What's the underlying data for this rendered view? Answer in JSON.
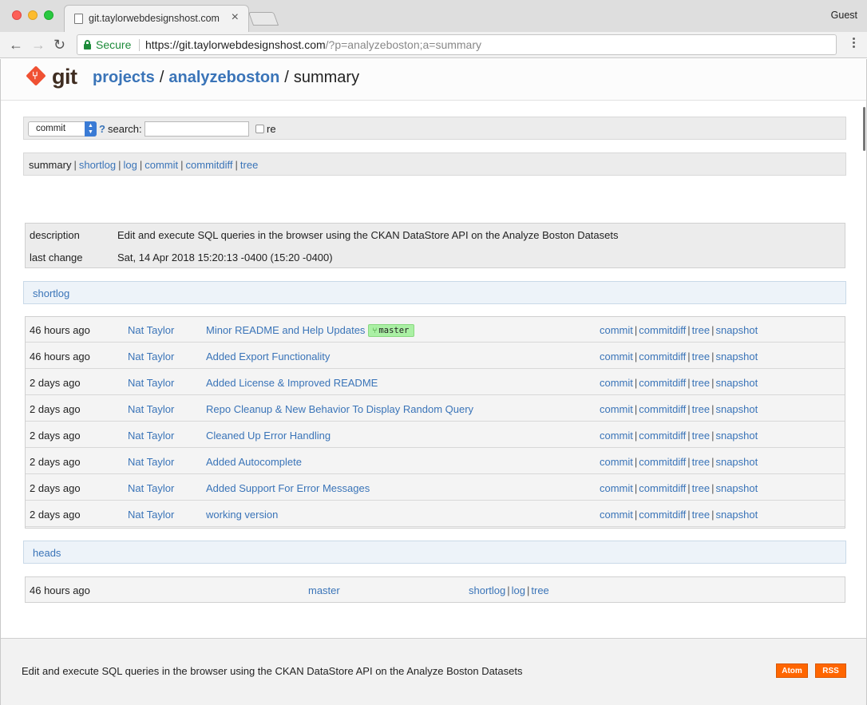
{
  "browser": {
    "tab_title": "git.taylorwebdesignshost.com",
    "tab_close": "×",
    "profile": "Guest",
    "secure_label": "Secure",
    "url_base": "https://git.taylorwebdesignshost.com",
    "url_query": "/?p=analyzeboston;a=summary",
    "back_icon": "←",
    "forward_icon": "→",
    "reload_icon": "↻"
  },
  "header": {
    "logo_text": "git",
    "crumbs": {
      "projects": "projects",
      "project": "analyzeboston",
      "sep": "/",
      "action": "summary"
    }
  },
  "search": {
    "type_value": "commit",
    "help": "?",
    "label": "search:",
    "query": "",
    "regex_label": "re",
    "regex_checked": false
  },
  "nav": {
    "current": "summary",
    "links": [
      "shortlog",
      "log",
      "commit",
      "commitdiff",
      "tree"
    ],
    "sep": "|"
  },
  "project_info": {
    "description_label": "description",
    "description": "Edit and execute SQL queries in the browser using the CKAN DataStore API on the Analyze Boston Datasets",
    "last_change_label": "last change",
    "last_change": "Sat, 14 Apr 2018 15:20:13 -0400 (15:20 -0400)"
  },
  "shortlog": {
    "title": "shortlog",
    "actions": [
      "commit",
      "commitdiff",
      "tree",
      "snapshot"
    ],
    "rows": [
      {
        "age": "46 hours ago",
        "author": "Nat Taylor",
        "subject": "Minor README and Help Updates",
        "ref": "master"
      },
      {
        "age": "46 hours ago",
        "author": "Nat Taylor",
        "subject": "Added Export Functionality",
        "ref": ""
      },
      {
        "age": "2 days ago",
        "author": "Nat Taylor",
        "subject": "Added License & Improved README",
        "ref": ""
      },
      {
        "age": "2 days ago",
        "author": "Nat Taylor",
        "subject": "Repo Cleanup & New Behavior To Display Random Query",
        "ref": ""
      },
      {
        "age": "2 days ago",
        "author": "Nat Taylor",
        "subject": "Cleaned Up Error Handling",
        "ref": ""
      },
      {
        "age": "2 days ago",
        "author": "Nat Taylor",
        "subject": "Added Autocomplete",
        "ref": ""
      },
      {
        "age": "2 days ago",
        "author": "Nat Taylor",
        "subject": "Added Support For Error Messages",
        "ref": ""
      },
      {
        "age": "2 days ago",
        "author": "Nat Taylor",
        "subject": "working version",
        "ref": ""
      }
    ]
  },
  "heads": {
    "title": "heads",
    "rows": [
      {
        "age": "46 hours ago",
        "name": "master",
        "links": [
          "shortlog",
          "log",
          "tree"
        ]
      }
    ]
  },
  "footer": {
    "description": "Edit and execute SQL queries in the browser using the CKAN DataStore API on the Analyze Boston Datasets",
    "atom": "Atom",
    "rss": "RSS"
  },
  "colors": {
    "link": "#3a74b8",
    "feed_button": "#ff6600",
    "ref_badge": "#aaf0a4",
    "git_logo": "#f05133"
  }
}
